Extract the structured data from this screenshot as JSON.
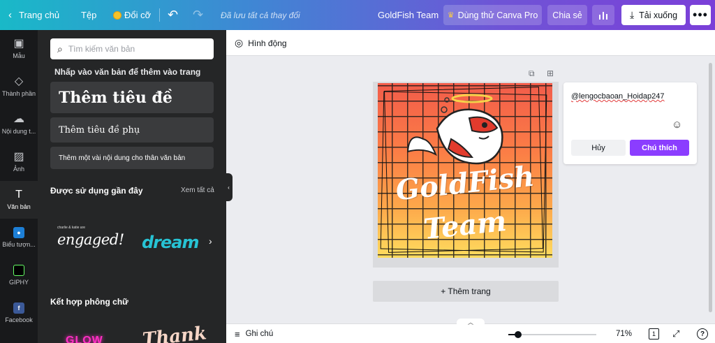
{
  "topbar": {
    "home": "Trang chủ",
    "file": "Tệp",
    "resize": "Đổi cỡ",
    "saved_status": "Đã lưu tất cả thay đổi",
    "design_title": "GoldFish Team",
    "try_pro": "Dùng thử Canva Pro",
    "share": "Chia sẻ",
    "download": "Tải xuống"
  },
  "leftnav": {
    "items": [
      {
        "label": "Mẫu",
        "icon": "template-icon"
      },
      {
        "label": "Thành phần",
        "icon": "elements-icon"
      },
      {
        "label": "Nội dung t...",
        "icon": "upload-icon"
      },
      {
        "label": "Ảnh",
        "icon": "photo-icon"
      },
      {
        "label": "Văn bản",
        "icon": "text-icon"
      },
      {
        "label": "Biểu tượn...",
        "icon": "logo-app-icon"
      },
      {
        "label": "GIPHY",
        "icon": "giphy-icon"
      },
      {
        "label": "Facebook",
        "icon": "facebook-icon"
      }
    ]
  },
  "panel": {
    "search_placeholder": "Tìm kiếm văn bản",
    "hint": "Nhấp vào văn bản để thêm vào trang",
    "add_heading": "Thêm tiêu đề",
    "add_subheading": "Thêm tiêu đề phụ",
    "add_body": "Thêm một vài nội dung cho thân văn bản",
    "recent_title": "Được sử dụng gần đây",
    "see_all": "Xem tất cả",
    "recent_a_small": "charlie & katie are",
    "recent_a_main": "engaged!",
    "recent_b": "dream",
    "combos_title": "Kết hợp phông chữ",
    "combo_a": "GLOW",
    "combo_b": "Thank"
  },
  "editor": {
    "animate": "Hình động",
    "add_page": "+ Thêm trang",
    "notes": "Ghi chú",
    "zoom": "71%",
    "zoom_level": 0.71,
    "page_count": "1"
  },
  "design": {
    "line1": "GoldFish",
    "line2": "Team",
    "colors": {
      "top": "#f25c4a",
      "bottom": "#fedc5e"
    }
  },
  "comment": {
    "mention": "@lengocbaoan_Hoidap247",
    "cancel": "Hủy",
    "post": "Chú thích"
  },
  "colors": {
    "accent": "#8b3dff",
    "sidebar": "#18191b",
    "panel": "#252627"
  }
}
